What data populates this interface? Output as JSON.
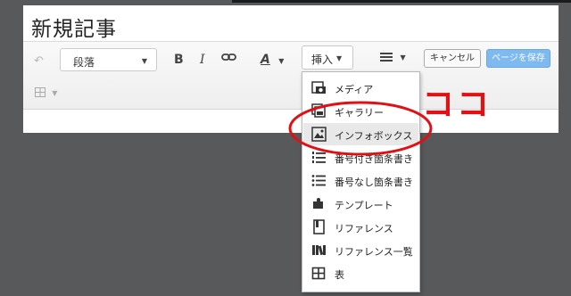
{
  "page": {
    "title": "新規記事"
  },
  "toolbar": {
    "paragraph_select": "段落",
    "bold": "B",
    "italic": "I",
    "underline_color": "A",
    "insert_label": "挿入",
    "cancel_label": "キャンセル",
    "save_label": "ページを保存"
  },
  "insert_menu": {
    "items": [
      {
        "label": "メディア",
        "icon": "media-icon"
      },
      {
        "label": "ギャラリー",
        "icon": "gallery-icon"
      },
      {
        "label": "インフォボックス",
        "icon": "infobox-icon",
        "highlighted": true
      },
      {
        "label": "番号付き箇条書き",
        "icon": "numbered-list-icon"
      },
      {
        "label": "番号なし箇条書き",
        "icon": "bulleted-list-icon"
      },
      {
        "label": "テンプレート",
        "icon": "template-icon"
      },
      {
        "label": "リファレンス",
        "icon": "reference-icon"
      },
      {
        "label": "リファレンス一覧",
        "icon": "reference-list-icon"
      },
      {
        "label": "表",
        "icon": "table-icon"
      }
    ]
  },
  "annotation": {
    "text": "ココ",
    "color": "#e01014"
  },
  "colors": {
    "background": "#58595b",
    "save_button": "#7eb9ef",
    "annotation_red": "#e01014"
  }
}
